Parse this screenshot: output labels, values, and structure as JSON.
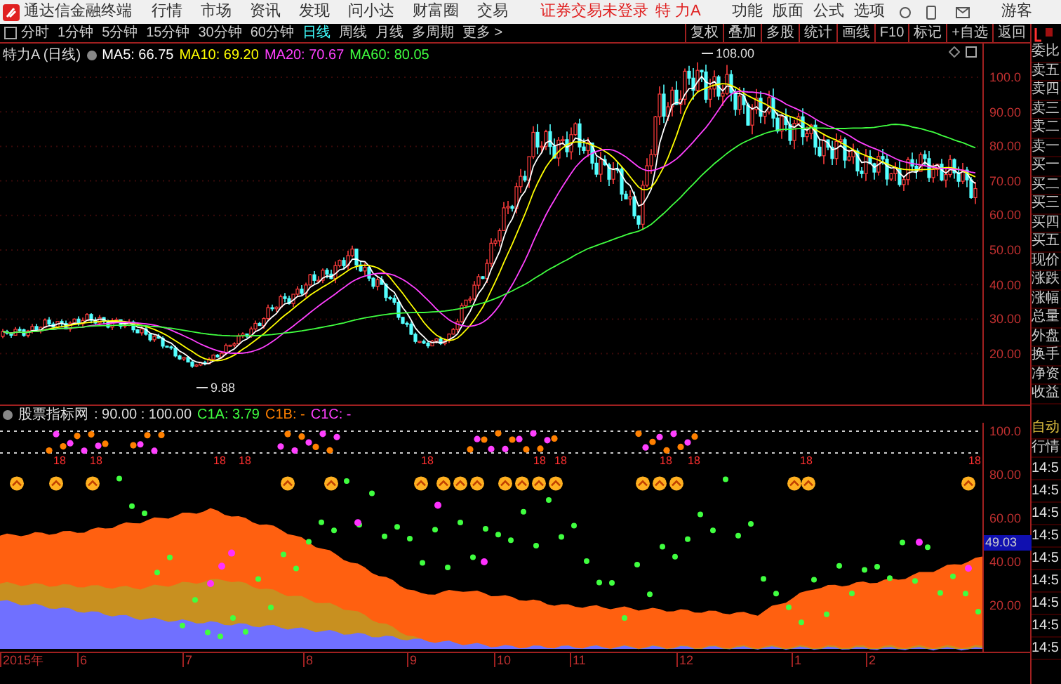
{
  "top_bar": {
    "app_title": "通达信金融终端",
    "menus": [
      "行情",
      "市场",
      "资讯",
      "发现",
      "问小达",
      "财富圈",
      "交易"
    ],
    "login_status": "证券交易未登录",
    "stock_name": "特 力A",
    "actions": [
      "功能",
      "版面",
      "公式",
      "选项"
    ],
    "user": "游客"
  },
  "period_tabs": [
    {
      "label": "分时",
      "selected": false
    },
    {
      "label": "1分钟",
      "selected": false
    },
    {
      "label": "5分钟",
      "selected": false
    },
    {
      "label": "15分钟",
      "selected": false
    },
    {
      "label": "30分钟",
      "selected": false
    },
    {
      "label": "60分钟",
      "selected": false
    },
    {
      "label": "日线",
      "selected": true
    },
    {
      "label": "周线",
      "selected": false
    },
    {
      "label": "月线",
      "selected": false
    },
    {
      "label": "多周期",
      "selected": false
    },
    {
      "label": "更多 >",
      "selected": false
    }
  ],
  "tools": [
    "复权",
    "叠加",
    "多股",
    "统计",
    "画线",
    "F10",
    "标记",
    "+自选",
    "返回"
  ],
  "chart_header": {
    "title": "特力A (日线)",
    "ma": [
      {
        "label": "MA5: 66.75",
        "color": "#ffffff"
      },
      {
        "label": "MA10: 69.20",
        "color": "#ffff00"
      },
      {
        "label": "MA20: 70.67",
        "color": "#ff40ff"
      },
      {
        "label": "MA60: 80.05",
        "color": "#40ff40"
      }
    ]
  },
  "price_axis": [
    "100.0",
    "90.00",
    "80.00",
    "70.00",
    "60.00",
    "50.00",
    "40.00",
    "30.00",
    "20.00"
  ],
  "annotations": {
    "high": "108.00",
    "low": "9.88"
  },
  "indicator": {
    "title": "股票指标网",
    "params": ": 90.00 : 100.00",
    "lines": [
      {
        "label": "C1A: 3.79",
        "color": "#40ff40"
      },
      {
        "label": "C1B: -",
        "color": "#ff8000"
      },
      {
        "label": "C1C: -",
        "color": "#ff40ff"
      }
    ],
    "markers": [
      "18",
      "18",
      "18",
      "18",
      "18",
      "18",
      "18",
      "18",
      "18",
      "18",
      "18"
    ],
    "axis": [
      {
        "label": "100.0",
        "kind": "tick"
      },
      {
        "label": "80.00",
        "kind": "tick"
      },
      {
        "label": "60.00",
        "kind": "tick"
      },
      {
        "label": "49.03",
        "kind": "current"
      },
      {
        "label": "40.00",
        "kind": "tick"
      },
      {
        "label": "20.00",
        "kind": "tick"
      }
    ]
  },
  "date_axis": [
    "2015年",
    "6",
    "7",
    "8",
    "9",
    "10",
    "11",
    "12",
    "1",
    "2"
  ],
  "side_panel": [
    {
      "label": "委比",
      "kind": "label"
    },
    {
      "label": "卖五",
      "kind": "label"
    },
    {
      "label": "卖四",
      "kind": "label"
    },
    {
      "label": "卖三",
      "kind": "label"
    },
    {
      "label": "卖二",
      "kind": "label"
    },
    {
      "label": "卖一",
      "kind": "label"
    },
    {
      "label": "买一",
      "kind": "label"
    },
    {
      "label": "买二",
      "kind": "label"
    },
    {
      "label": "买三",
      "kind": "label"
    },
    {
      "label": "买四",
      "kind": "label"
    },
    {
      "label": "买五",
      "kind": "label"
    },
    {
      "label": "现价",
      "kind": "label"
    },
    {
      "label": "涨跌",
      "kind": "label"
    },
    {
      "label": "涨幅",
      "kind": "label"
    },
    {
      "label": "总量",
      "kind": "label"
    },
    {
      "label": "外盘",
      "kind": "label"
    },
    {
      "label": "换手",
      "kind": "label"
    },
    {
      "label": "净资",
      "kind": "label"
    },
    {
      "label": "收益",
      "kind": "label"
    },
    {
      "label": "自动",
      "kind": "mode"
    },
    {
      "label": "行情",
      "kind": "label"
    },
    {
      "label": "14:5",
      "kind": "time"
    },
    {
      "label": "14:5",
      "kind": "time"
    },
    {
      "label": "14:5",
      "kind": "time"
    },
    {
      "label": "14:5",
      "kind": "time"
    },
    {
      "label": "14:5",
      "kind": "time"
    },
    {
      "label": "14:5",
      "kind": "time"
    },
    {
      "label": "14:5",
      "kind": "time"
    },
    {
      "label": "14:5",
      "kind": "time"
    },
    {
      "label": "14:5",
      "kind": "time"
    }
  ]
}
